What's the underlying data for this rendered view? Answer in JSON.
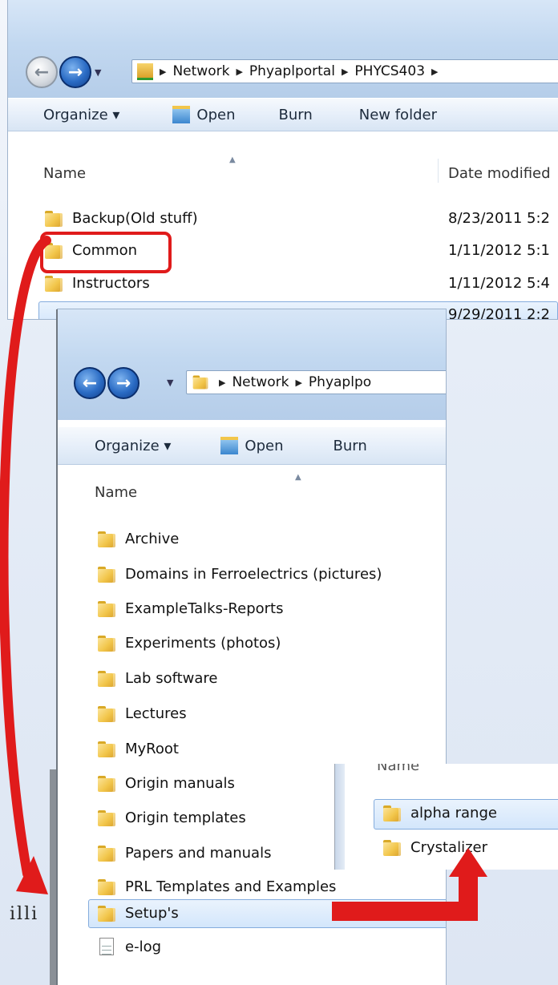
{
  "window1": {
    "breadcrumb": [
      "Network",
      "Phyaplportal",
      "PHYCS403"
    ],
    "toolbar": {
      "organize": "Organize ▾",
      "open": "Open",
      "burn": "Burn",
      "new_folder": "New folder"
    },
    "columns": {
      "name": "Name",
      "date_modified": "Date modified"
    },
    "rows": [
      {
        "name": "Backup(Old stuff)",
        "date": "8/23/2011 5:2"
      },
      {
        "name": "Common",
        "date": "1/11/2012 5:1"
      },
      {
        "name": "Instructors",
        "date": "1/11/2012 5:4"
      },
      {
        "name": "",
        "date": "9/29/2011 2:2"
      }
    ]
  },
  "window2": {
    "breadcrumb": [
      "Network",
      "Phyaplpo"
    ],
    "toolbar": {
      "organize": "Organize ▾",
      "open": "Open",
      "burn": "Burn"
    },
    "columns": {
      "name": "Name"
    },
    "rows": [
      {
        "name": "Archive"
      },
      {
        "name": "Domains in Ferroelectrics (pictures)"
      },
      {
        "name": "ExampleTalks-Reports"
      },
      {
        "name": "Experiments (photos)"
      },
      {
        "name": "Lab software"
      },
      {
        "name": "Lectures"
      },
      {
        "name": "MyRoot"
      },
      {
        "name": "Origin manuals"
      },
      {
        "name": "Origin templates"
      },
      {
        "name": "Papers and manuals"
      },
      {
        "name": "PRL Templates and Examples"
      },
      {
        "name": "Setup's"
      },
      {
        "name": "e-log"
      }
    ]
  },
  "window3": {
    "column_partial": "Name",
    "rows": [
      {
        "name": "alpha range"
      },
      {
        "name": "Crystalizer"
      }
    ]
  },
  "background_text": "illi",
  "colors": {
    "highlight_red": "#e01b1b",
    "selection_blue": "#84acdd",
    "folder_yellow": "#f2c64b"
  }
}
